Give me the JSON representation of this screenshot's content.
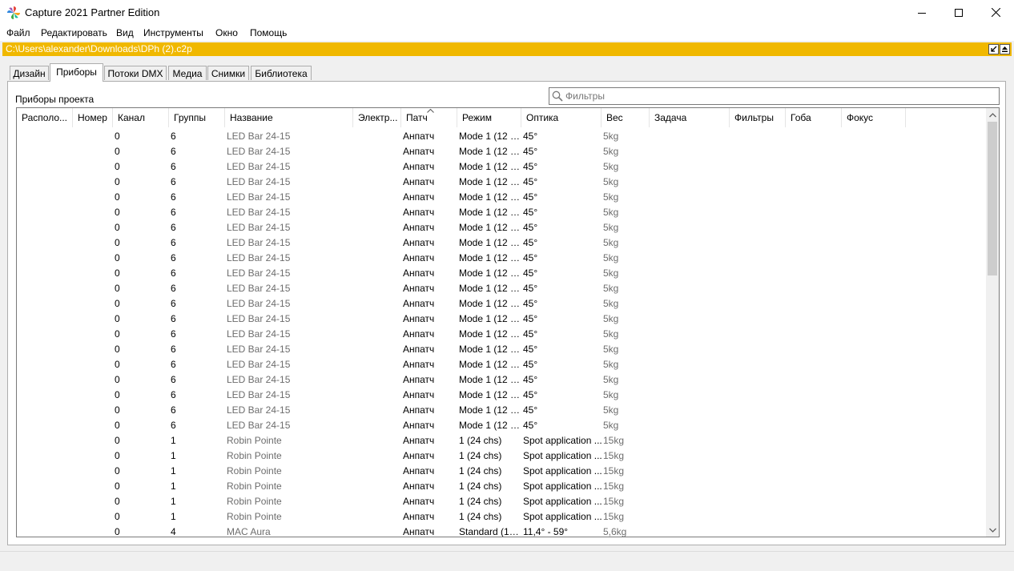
{
  "window": {
    "title": "Capture 2021 Partner Edition",
    "icon": "capture-logo-icon",
    "controls": [
      "minimize-icon",
      "maximize-icon",
      "close-icon"
    ]
  },
  "menu": [
    "Файл",
    "Редактировать",
    "Вид",
    "Инструменты",
    "Окно",
    "Помощь"
  ],
  "path_bar": {
    "path": "C:\\Users\\alexander\\Downloads\\DPh (2).c2p",
    "accent": "#f0b800"
  },
  "tabs": [
    "Дизайн",
    "Приборы",
    "Потоки DMX",
    "Медиа",
    "Снимки",
    "Библиотека"
  ],
  "active_tab": "Приборы",
  "section": {
    "title": "Приборы проекта"
  },
  "filter": {
    "placeholder": "Фильтры"
  },
  "columns": [
    "Располо...",
    "Номер",
    "Канал",
    "Группы",
    "Название",
    "Электр...",
    "Патч",
    "Режим",
    "Оптика",
    "Вес",
    "Задача",
    "Фильтры",
    "Гоба",
    "Фокус"
  ],
  "rows": [
    {
      "channel": "0",
      "groups": "6",
      "name": "LED Bar 24-15",
      "patch": "Анпатч",
      "mode": "Mode 1 (12 c...",
      "optics": "45°",
      "weight": "5kg"
    },
    {
      "channel": "0",
      "groups": "6",
      "name": "LED Bar 24-15",
      "patch": "Анпатч",
      "mode": "Mode 1 (12 c...",
      "optics": "45°",
      "weight": "5kg"
    },
    {
      "channel": "0",
      "groups": "6",
      "name": "LED Bar 24-15",
      "patch": "Анпатч",
      "mode": "Mode 1 (12 c...",
      "optics": "45°",
      "weight": "5kg"
    },
    {
      "channel": "0",
      "groups": "6",
      "name": "LED Bar 24-15",
      "patch": "Анпатч",
      "mode": "Mode 1 (12 c...",
      "optics": "45°",
      "weight": "5kg"
    },
    {
      "channel": "0",
      "groups": "6",
      "name": "LED Bar 24-15",
      "patch": "Анпатч",
      "mode": "Mode 1 (12 c...",
      "optics": "45°",
      "weight": "5kg"
    },
    {
      "channel": "0",
      "groups": "6",
      "name": "LED Bar 24-15",
      "patch": "Анпатч",
      "mode": "Mode 1 (12 c...",
      "optics": "45°",
      "weight": "5kg"
    },
    {
      "channel": "0",
      "groups": "6",
      "name": "LED Bar 24-15",
      "patch": "Анпатч",
      "mode": "Mode 1 (12 c...",
      "optics": "45°",
      "weight": "5kg"
    },
    {
      "channel": "0",
      "groups": "6",
      "name": "LED Bar 24-15",
      "patch": "Анпатч",
      "mode": "Mode 1 (12 c...",
      "optics": "45°",
      "weight": "5kg"
    },
    {
      "channel": "0",
      "groups": "6",
      "name": "LED Bar 24-15",
      "patch": "Анпатч",
      "mode": "Mode 1 (12 c...",
      "optics": "45°",
      "weight": "5kg"
    },
    {
      "channel": "0",
      "groups": "6",
      "name": "LED Bar 24-15",
      "patch": "Анпатч",
      "mode": "Mode 1 (12 c...",
      "optics": "45°",
      "weight": "5kg"
    },
    {
      "channel": "0",
      "groups": "6",
      "name": "LED Bar 24-15",
      "patch": "Анпатч",
      "mode": "Mode 1 (12 c...",
      "optics": "45°",
      "weight": "5kg"
    },
    {
      "channel": "0",
      "groups": "6",
      "name": "LED Bar 24-15",
      "patch": "Анпатч",
      "mode": "Mode 1 (12 c...",
      "optics": "45°",
      "weight": "5kg"
    },
    {
      "channel": "0",
      "groups": "6",
      "name": "LED Bar 24-15",
      "patch": "Анпатч",
      "mode": "Mode 1 (12 c...",
      "optics": "45°",
      "weight": "5kg"
    },
    {
      "channel": "0",
      "groups": "6",
      "name": "LED Bar 24-15",
      "patch": "Анпатч",
      "mode": "Mode 1 (12 c...",
      "optics": "45°",
      "weight": "5kg"
    },
    {
      "channel": "0",
      "groups": "6",
      "name": "LED Bar 24-15",
      "patch": "Анпатч",
      "mode": "Mode 1 (12 c...",
      "optics": "45°",
      "weight": "5kg"
    },
    {
      "channel": "0",
      "groups": "6",
      "name": "LED Bar 24-15",
      "patch": "Анпатч",
      "mode": "Mode 1 (12 c...",
      "optics": "45°",
      "weight": "5kg"
    },
    {
      "channel": "0",
      "groups": "6",
      "name": "LED Bar 24-15",
      "patch": "Анпатч",
      "mode": "Mode 1 (12 c...",
      "optics": "45°",
      "weight": "5kg"
    },
    {
      "channel": "0",
      "groups": "6",
      "name": "LED Bar 24-15",
      "patch": "Анпатч",
      "mode": "Mode 1 (12 c...",
      "optics": "45°",
      "weight": "5kg"
    },
    {
      "channel": "0",
      "groups": "6",
      "name": "LED Bar 24-15",
      "patch": "Анпатч",
      "mode": "Mode 1 (12 c...",
      "optics": "45°",
      "weight": "5kg"
    },
    {
      "channel": "0",
      "groups": "6",
      "name": "LED Bar 24-15",
      "patch": "Анпатч",
      "mode": "Mode 1 (12 c...",
      "optics": "45°",
      "weight": "5kg"
    },
    {
      "channel": "0",
      "groups": "1",
      "name": "Robin Pointe",
      "patch": "Анпатч",
      "mode": "1 (24 chs)",
      "optics": "Spot application ...",
      "weight": "15kg"
    },
    {
      "channel": "0",
      "groups": "1",
      "name": "Robin Pointe",
      "patch": "Анпатч",
      "mode": "1 (24 chs)",
      "optics": "Spot application ...",
      "weight": "15kg"
    },
    {
      "channel": "0",
      "groups": "1",
      "name": "Robin Pointe",
      "patch": "Анпатч",
      "mode": "1 (24 chs)",
      "optics": "Spot application ...",
      "weight": "15kg"
    },
    {
      "channel": "0",
      "groups": "1",
      "name": "Robin Pointe",
      "patch": "Анпатч",
      "mode": "1 (24 chs)",
      "optics": "Spot application ...",
      "weight": "15kg"
    },
    {
      "channel": "0",
      "groups": "1",
      "name": "Robin Pointe",
      "patch": "Анпатч",
      "mode": "1 (24 chs)",
      "optics": "Spot application ...",
      "weight": "15kg"
    },
    {
      "channel": "0",
      "groups": "1",
      "name": "Robin Pointe",
      "patch": "Анпатч",
      "mode": "1 (24 chs)",
      "optics": "Spot application ...",
      "weight": "15kg"
    },
    {
      "channel": "0",
      "groups": "4",
      "name": "MAC Aura",
      "patch": "Анпатч",
      "mode": "Standard (14 ...",
      "optics": "11,4° - 59°",
      "weight": "5,6kg"
    }
  ]
}
